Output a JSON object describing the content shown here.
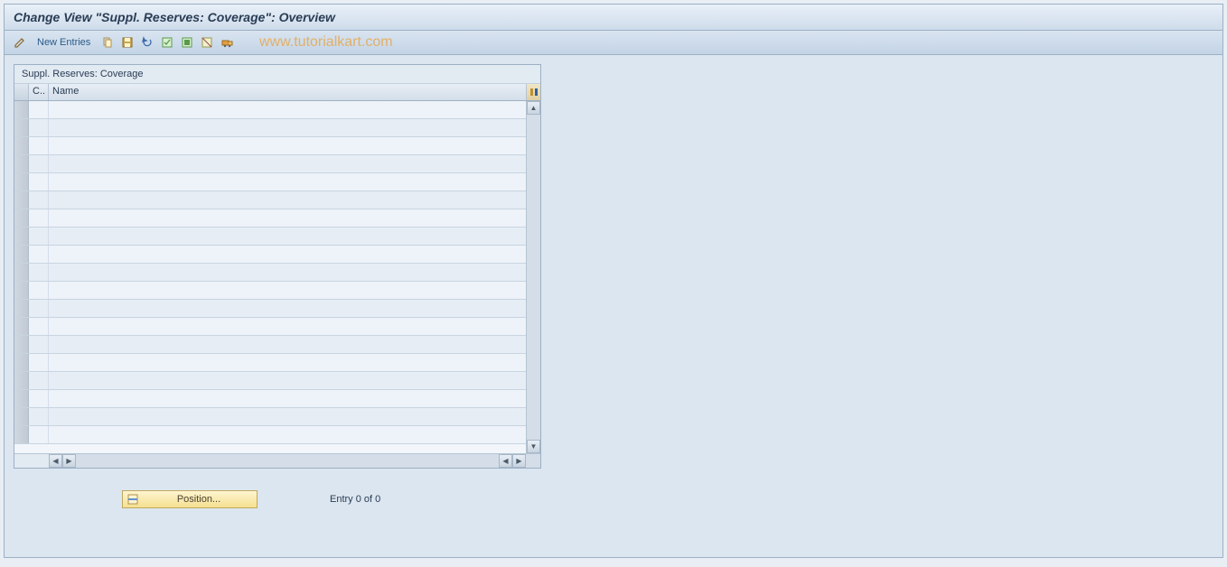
{
  "header": {
    "title": "Change View \"Suppl. Reserves: Coverage\": Overview"
  },
  "toolbar": {
    "new_entries_label": "New Entries"
  },
  "watermark": "www.tutorialkart.com",
  "table": {
    "title": "Suppl. Reserves: Coverage",
    "columns": {
      "c": "C..",
      "name": "Name"
    },
    "row_count": 19
  },
  "footer": {
    "position_label": "Position...",
    "entry_text": "Entry 0 of 0"
  }
}
